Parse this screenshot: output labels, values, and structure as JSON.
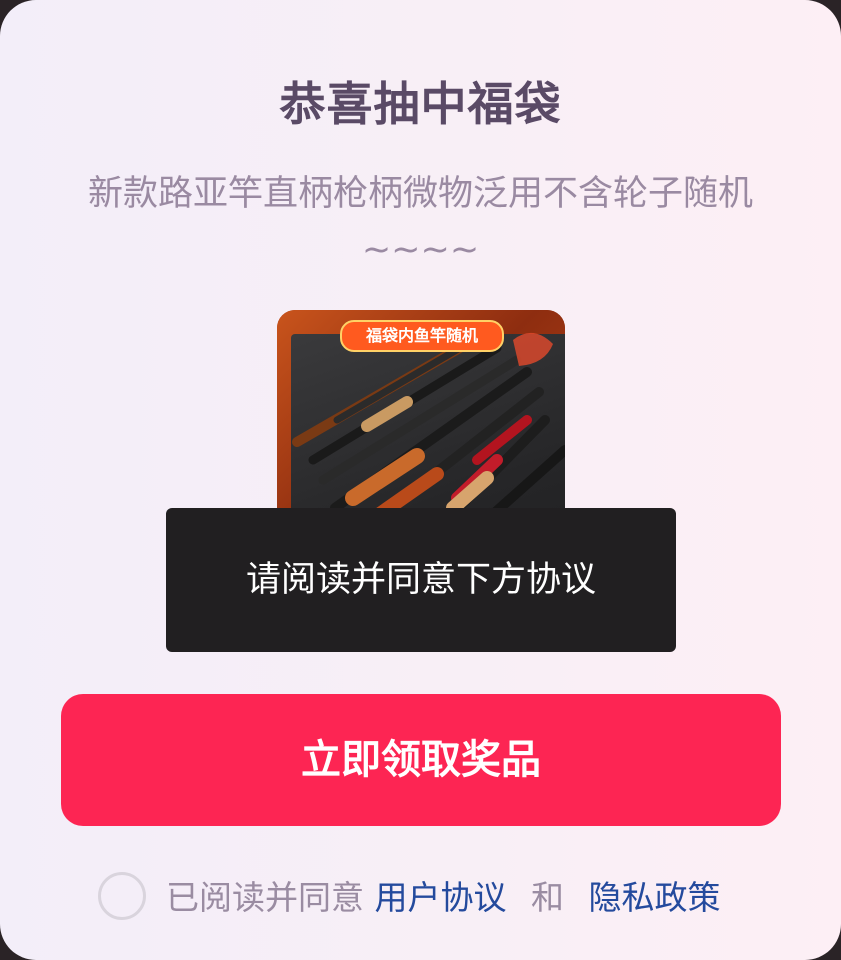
{
  "dialog": {
    "title": "恭喜抽中福袋",
    "subtitle": "新款路亚竿直柄枪柄微物泛用不含轮子随机~~~~"
  },
  "product": {
    "badge": "福袋内鱼竿随机",
    "image_icon": "fishing-rods-image"
  },
  "toast": {
    "message": "请阅读并同意下方协议"
  },
  "claim_button": {
    "label": "立即领取奖品"
  },
  "agreement": {
    "prefix": "已阅读并同意",
    "user_agreement": "用户协议",
    "conjunction": "和",
    "privacy_policy": "隐私政策",
    "checked": false
  },
  "colors": {
    "accent": "#fd2553",
    "link": "#244a9d",
    "title": "#5a4a66",
    "toast_bg": "#211f21"
  }
}
